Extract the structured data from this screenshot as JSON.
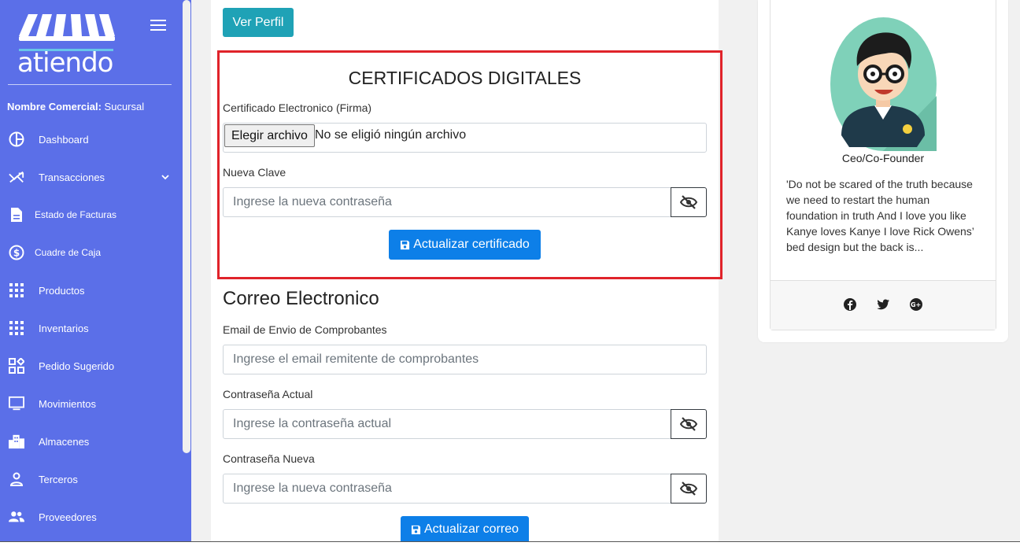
{
  "sidebar": {
    "logo_text": "atiendo",
    "company_label": "Nombre Comercial:",
    "company_value": "Sucursal",
    "items": [
      {
        "label": "Dashboard",
        "icon": "dashboard-icon"
      },
      {
        "label": "Transacciones",
        "icon": "transactions-icon"
      },
      {
        "label": "Estado de Facturas",
        "icon": "invoice-icon"
      },
      {
        "label": "Cuadre de Caja",
        "icon": "dollar-icon"
      },
      {
        "label": "Productos",
        "icon": "grid-icon"
      },
      {
        "label": "Inventarios",
        "icon": "grid-icon"
      },
      {
        "label": "Pedido Sugerido",
        "icon": "widgets-icon"
      },
      {
        "label": "Movimientos",
        "icon": "monitor-icon"
      },
      {
        "label": "Almacenes",
        "icon": "buildings-icon"
      },
      {
        "label": "Terceros",
        "icon": "person-icon"
      },
      {
        "label": "Proveedores",
        "icon": "people-icon"
      }
    ]
  },
  "main": {
    "ver_perfil": "Ver Perfil",
    "cert": {
      "title": "CERTIFICADOS DIGITALES",
      "file_label": "Certificado Electronico (Firma)",
      "file_button": "Elegir archivo",
      "file_status": "No se eligió ningún archivo",
      "password_label": "Nueva Clave",
      "password_placeholder": "Ingrese la nueva contraseña",
      "submit": "Actualizar certificado"
    },
    "email": {
      "title": "Correo Electronico",
      "email_label": "Email de Envio de Comprobantes",
      "email_placeholder": "Ingrese el email remitente de comprobantes",
      "current_label": "Contraseña Actual",
      "current_placeholder": "Ingrese la contraseña actual",
      "new_label": "Contraseña Nueva",
      "new_placeholder": "Ingrese la nueva contraseña",
      "submit": "Actualizar correo"
    }
  },
  "profile": {
    "role": "Ceo/Co-Founder",
    "quote": "'Do not be scared of the truth because we need to restart the human foundation in truth And I love you like Kanye loves Kanye I love Rick Owens’ bed design but the back is...",
    "social": [
      "facebook-icon",
      "twitter-icon",
      "google-plus-icon"
    ]
  },
  "colors": {
    "sidebar": "#5b6fe8",
    "primary": "#0d7fe8",
    "info": "#1fa2b6",
    "highlight": "#e0232a"
  }
}
